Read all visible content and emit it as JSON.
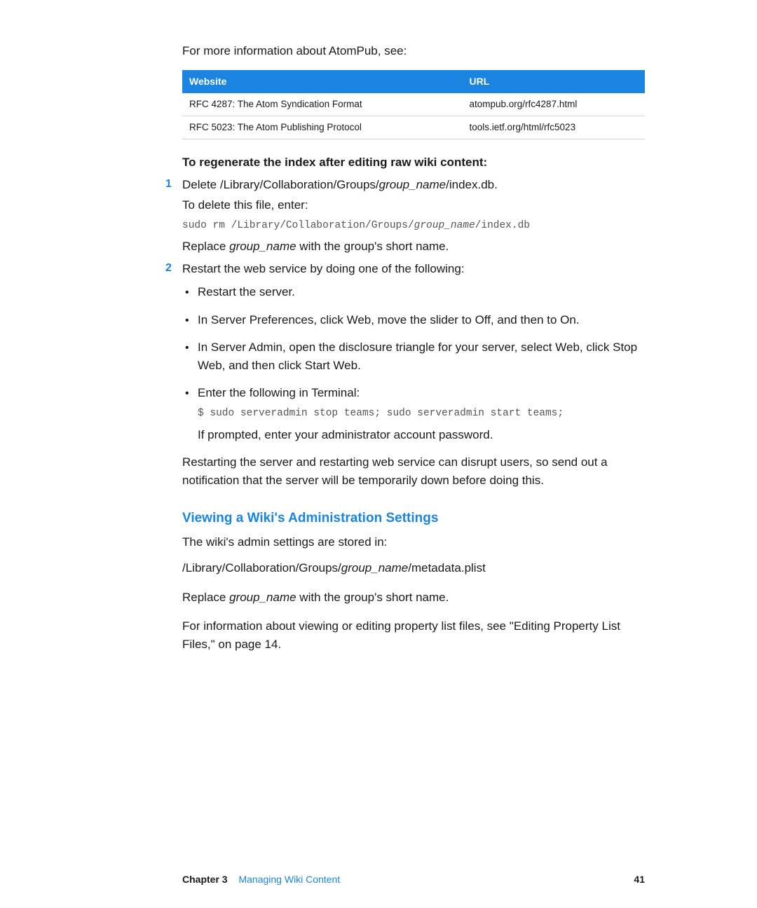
{
  "intro": "For more information about AtomPub, see:",
  "table": {
    "h1": "Website",
    "h2": "URL",
    "r1c1": "RFC 4287: The Atom Syndication Format",
    "r1c2": "atompub.org/rfc4287.html",
    "r2c1": "RFC 5023: The Atom Publishing Protocol",
    "r2c2": "tools.ietf.org/html/rfc5023"
  },
  "regen_heading": "To regenerate the index after editing raw wiki content:",
  "step1": {
    "num": "1",
    "line_prefix": "Delete /Library/Collaboration/Groups/",
    "line_italic": "group_name",
    "line_suffix": "/index.db.",
    "sub": "To delete this file, enter:",
    "code_prefix": "sudo rm /Library/Collaboration/Groups/",
    "code_italic": "group_name",
    "code_suffix": "/index.db",
    "replace_prefix": "Replace ",
    "replace_italic": "group_name",
    "replace_suffix": " with the group's short name."
  },
  "step2": {
    "num": "2",
    "line": "Restart the web service by doing one of the following:",
    "b1": "Restart the server.",
    "b2": "In Server Preferences, click Web, move the slider to Off, and then to On.",
    "b3": "In Server Admin, open the disclosure triangle for your server, select Web, click Stop Web, and then click Start Web.",
    "b4": "Enter the following in Terminal:",
    "b4_code": "$ sudo serveradmin stop teams; sudo serveradmin start teams;",
    "b4_sub": "If prompted, enter your administrator account password."
  },
  "restart_note": "Restarting the server and restarting web service can disrupt users, so send out a notification that the server will be temporarily down before doing this.",
  "section": {
    "heading": "Viewing a Wiki's Administration Settings",
    "p1": "The wiki's admin settings are stored in:",
    "p2_prefix": "/Library/Collaboration/Groups/",
    "p2_italic": "group_name",
    "p2_suffix": "/metadata.plist",
    "p3_prefix": "Replace ",
    "p3_italic": "group_name",
    "p3_suffix": " with the group's short name.",
    "p4": "For information about viewing or editing property list files, see \"Editing Property List Files,\" on page 14."
  },
  "footer": {
    "chapter": "Chapter 3",
    "title": "Managing Wiki Content",
    "page": "41"
  }
}
